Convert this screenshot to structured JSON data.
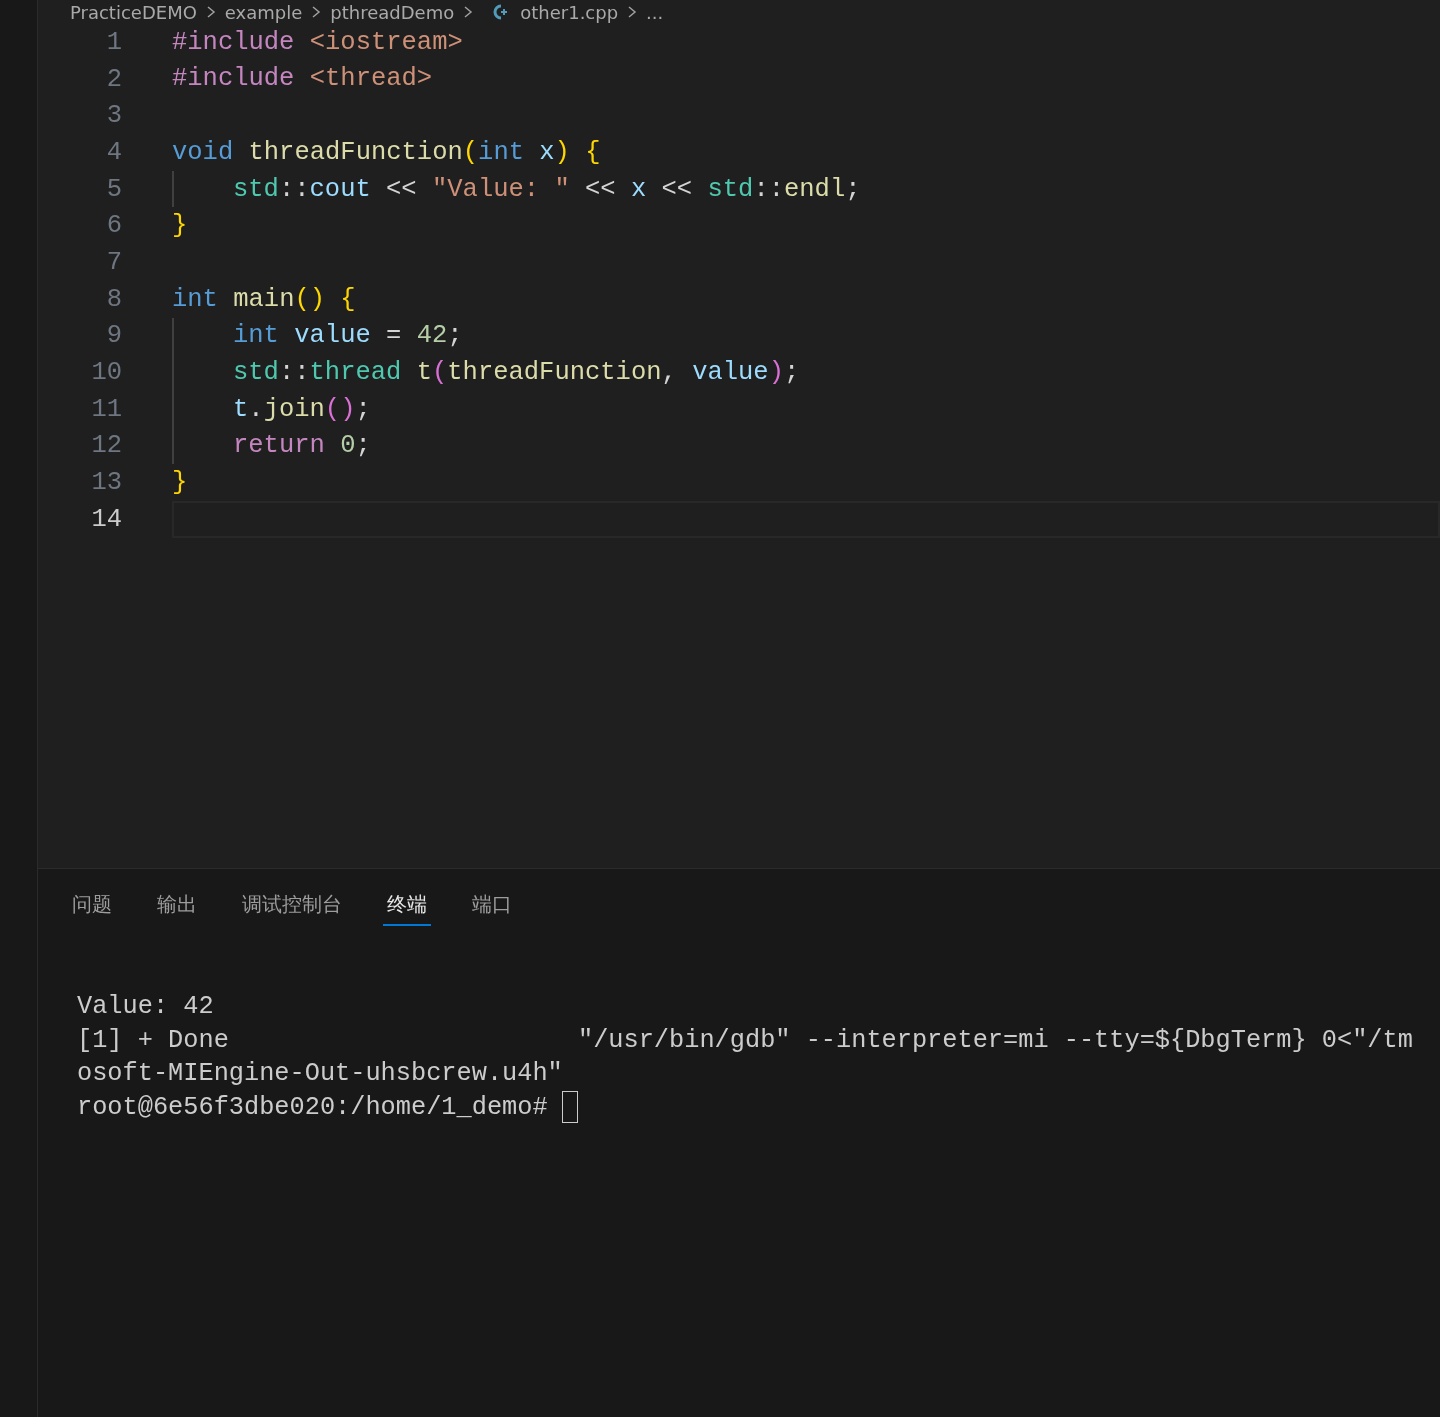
{
  "breadcrumb": [
    "PracticeDEMO",
    "example",
    "pthreadDemo",
    "other1.cpp",
    "..."
  ],
  "editor": {
    "lines": [
      {
        "number": "1",
        "current": false,
        "tokens": [
          {
            "t": "#include ",
            "kind": "preprocessor"
          },
          {
            "t": "<iostream>",
            "kind": "string"
          }
        ]
      },
      {
        "number": "2",
        "current": false,
        "tokens": [
          {
            "t": "#include ",
            "kind": "preprocessor"
          },
          {
            "t": "<thread>",
            "kind": "string"
          }
        ]
      },
      {
        "number": "3",
        "current": false
      },
      {
        "number": "4",
        "current": false,
        "tokens": [
          {
            "t": "void ",
            "kind": "keyword"
          },
          {
            "t": "threadFunction",
            "kind": "function"
          },
          {
            "t": "(",
            "kind": "bracket"
          },
          {
            "t": "int ",
            "kind": "keyword"
          },
          {
            "t": "x",
            "kind": "variable"
          },
          {
            "t": ") {",
            "kind": "bracket"
          }
        ]
      },
      {
        "number": "5",
        "current": false,
        "indent": true,
        "tokens": [
          {
            "t": "std",
            "kind": "type"
          },
          {
            "t": "::",
            "kind": "plain"
          },
          {
            "t": "cout",
            "kind": "variable"
          },
          {
            "t": " << ",
            "kind": "plain"
          },
          {
            "t": "\"Value: \"",
            "kind": "string"
          },
          {
            "t": " << ",
            "kind": "plain"
          },
          {
            "t": "x",
            "kind": "variable"
          },
          {
            "t": " << ",
            "kind": "plain"
          },
          {
            "t": "std",
            "kind": "type"
          },
          {
            "t": "::",
            "kind": "plain"
          },
          {
            "t": "endl",
            "kind": "function"
          },
          {
            "t": ";",
            "kind": "plain"
          }
        ]
      },
      {
        "number": "6",
        "current": false,
        "tokens": [
          {
            "t": "}",
            "kind": "bracket"
          }
        ]
      },
      {
        "number": "7",
        "current": false
      },
      {
        "number": "8",
        "current": false,
        "tokens": [
          {
            "t": "int ",
            "kind": "keyword"
          },
          {
            "t": "main",
            "kind": "function"
          },
          {
            "t": "() {",
            "kind": "bracket"
          }
        ]
      },
      {
        "number": "9",
        "current": false,
        "indent": true,
        "tokens": [
          {
            "t": "int ",
            "kind": "keyword"
          },
          {
            "t": "value",
            "kind": "variable"
          },
          {
            "t": " = ",
            "kind": "plain"
          },
          {
            "t": "42",
            "kind": "number"
          },
          {
            "t": ";",
            "kind": "plain"
          }
        ]
      },
      {
        "number": "10",
        "current": false,
        "indent": true,
        "tokens": [
          {
            "t": "std",
            "kind": "type"
          },
          {
            "t": "::",
            "kind": "plain"
          },
          {
            "t": "thread ",
            "kind": "type"
          },
          {
            "t": "t",
            "kind": "function"
          },
          {
            "t": "(",
            "kind": "bracket2"
          },
          {
            "t": "threadFunction",
            "kind": "function"
          },
          {
            "t": ", ",
            "kind": "plain"
          },
          {
            "t": "value",
            "kind": "variable"
          },
          {
            "t": ")",
            "kind": "bracket2"
          },
          {
            "t": ";",
            "kind": "plain"
          }
        ]
      },
      {
        "number": "11",
        "current": false,
        "indent": true,
        "tokens": [
          {
            "t": "t",
            "kind": "variable"
          },
          {
            "t": ".",
            "kind": "plain"
          },
          {
            "t": "join",
            "kind": "function"
          },
          {
            "t": "()",
            "kind": "bracket2"
          },
          {
            "t": ";",
            "kind": "plain"
          }
        ]
      },
      {
        "number": "12",
        "current": false,
        "indent": true,
        "tokens": [
          {
            "t": "return ",
            "kind": "control"
          },
          {
            "t": "0",
            "kind": "number"
          },
          {
            "t": ";",
            "kind": "plain"
          }
        ]
      },
      {
        "number": "13",
        "current": false,
        "tokens": [
          {
            "t": "}",
            "kind": "bracket"
          }
        ]
      },
      {
        "number": "14",
        "current": true
      }
    ]
  },
  "panel": {
    "tabs": [
      {
        "label": "问题",
        "selected": false
      },
      {
        "label": "输出",
        "selected": false
      },
      {
        "label": "调试控制台",
        "selected": false
      },
      {
        "label": "终端",
        "selected": true
      },
      {
        "label": "端口",
        "selected": false
      }
    ],
    "terminal": {
      "lines": [
        "Value: 42",
        "[1] + Done                       \"/usr/bin/gdb\" --interpreter=mi --tty=${DbgTerm} 0<\"/tm",
        "osoft-MIEngine-Out-uhsbcrew.u4h\""
      ],
      "prompt": "root@6e56f3dbe020:/home/1_demo#"
    }
  }
}
